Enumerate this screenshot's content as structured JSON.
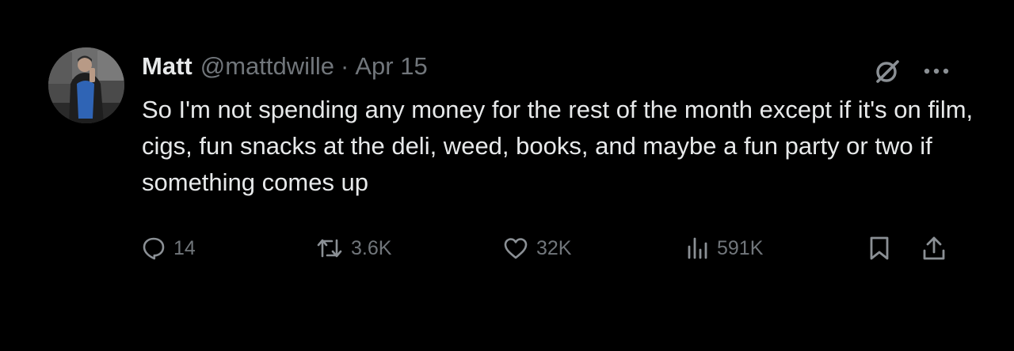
{
  "author": {
    "name": "Matt",
    "handle": "@mattdwille",
    "separator": "·",
    "date": "Apr 15"
  },
  "tweet": {
    "text": "So I'm not spending any money for the rest of the month except if it's on film, cigs, fun snacks at the deli, weed, books, and maybe a fun party or two if something comes up"
  },
  "actions": {
    "replies": "14",
    "reposts": "3.6K",
    "likes": "32K",
    "views": "591K"
  },
  "icons": {
    "avatar": "profile-photo",
    "top": [
      "grok-icon",
      "more-icon"
    ],
    "bar": [
      "reply-icon",
      "repost-icon",
      "like-icon",
      "views-icon",
      "bookmark-icon",
      "share-icon"
    ]
  },
  "colors": {
    "background": "#000000",
    "primary_text": "#e7e9ea",
    "secondary_text": "#71767b"
  }
}
